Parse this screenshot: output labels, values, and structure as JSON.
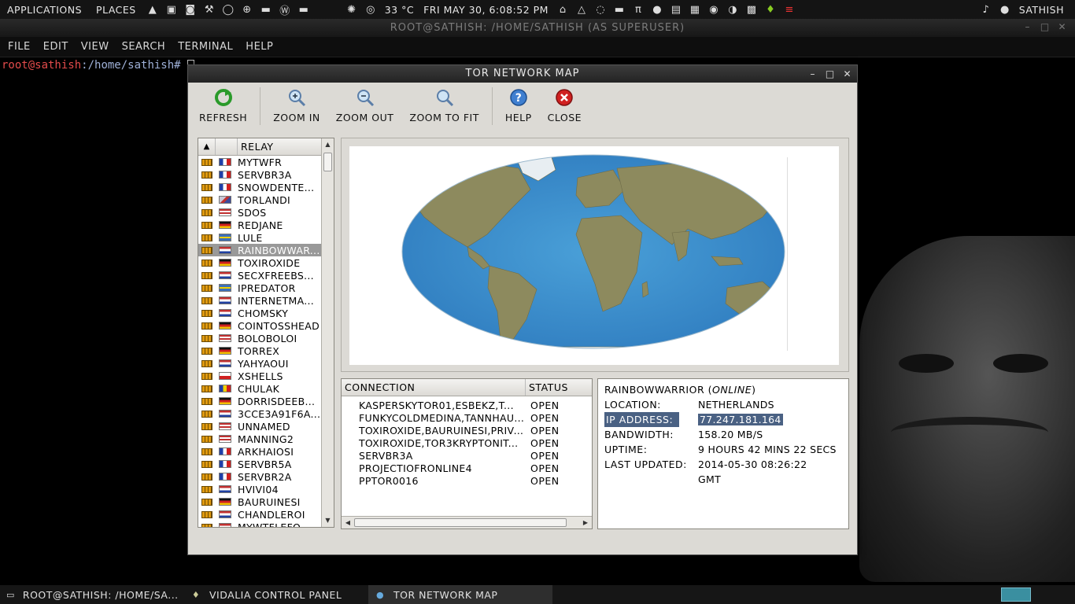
{
  "top_panel": {
    "applications": "APPLICATIONS",
    "places": "PLACES",
    "weather": "33 °C",
    "clock": "FRI MAY 30,  6:08:52 PM",
    "user": "SATHISH"
  },
  "terminal": {
    "title": "ROOT@SATHISH: /HOME/SATHISH (AS SUPERUSER)",
    "menu": [
      "FILE",
      "EDIT",
      "VIEW",
      "SEARCH",
      "TERMINAL",
      "HELP"
    ],
    "prompt_user": "root@sathish",
    "prompt_path": ":/home/sathish#"
  },
  "window": {
    "title": "TOR NETWORK MAP",
    "toolbar": {
      "refresh": "REFRESH",
      "zoom_in": "ZOOM IN",
      "zoom_out": "ZOOM OUT",
      "zoom_fit": "ZOOM TO FIT",
      "help": "HELP",
      "close": "CLOSE"
    }
  },
  "relay_list": {
    "header": "RELAY",
    "items": [
      {
        "name": "MYTWFR",
        "flag": "fr"
      },
      {
        "name": "SERVBR3A",
        "flag": "fr"
      },
      {
        "name": "SNOWDENTE...",
        "flag": "fr"
      },
      {
        "name": "TORLANDI",
        "flag": "gb"
      },
      {
        "name": "SDOS",
        "flag": "us"
      },
      {
        "name": "REDJANE",
        "flag": "de"
      },
      {
        "name": "LULE",
        "flag": "se"
      },
      {
        "name": "RAINBOWWAR...",
        "flag": "nl",
        "selected": true
      },
      {
        "name": "TOXIROXIDE",
        "flag": "de"
      },
      {
        "name": "SECXFREEBS...",
        "flag": "nl"
      },
      {
        "name": "IPREDATOR",
        "flag": "se"
      },
      {
        "name": "INTERNETMA...",
        "flag": "nl"
      },
      {
        "name": "CHOMSKY",
        "flag": "nl"
      },
      {
        "name": "COINTOSSHEAD",
        "flag": "de"
      },
      {
        "name": "BOLOBOLOI",
        "flag": "us"
      },
      {
        "name": "TORREX",
        "flag": "de"
      },
      {
        "name": "YAHYAOUI",
        "flag": "nl"
      },
      {
        "name": "XSHELLS",
        "flag": "pl"
      },
      {
        "name": "CHULAK",
        "flag": "ro"
      },
      {
        "name": "DORRISDEEB...",
        "flag": "de"
      },
      {
        "name": "3CCE3A91F6A...",
        "flag": "nl"
      },
      {
        "name": "UNNAMED",
        "flag": "us"
      },
      {
        "name": "MANNING2",
        "flag": "us"
      },
      {
        "name": "ARKHAIOSI",
        "flag": "fr"
      },
      {
        "name": "SERVBR5A",
        "flag": "fr"
      },
      {
        "name": "SERVBR2A",
        "flag": "fr"
      },
      {
        "name": "HVIVI04",
        "flag": "nl"
      },
      {
        "name": "BAURUINESI",
        "flag": "de"
      },
      {
        "name": "CHANDLEROI",
        "flag": "nl"
      },
      {
        "name": "MYWTFLEFO",
        "flag": "nl"
      }
    ]
  },
  "connections": {
    "header_connection": "CONNECTION",
    "header_status": "STATUS",
    "rows": [
      {
        "name": "KASPERSKYTOR01,ESBEKZ,T...",
        "status": "OPEN"
      },
      {
        "name": "FUNKYCOLDMEDINA,TANNHAU...",
        "status": "OPEN"
      },
      {
        "name": "TOXIROXIDE,BAURUINESI,PRIVA...",
        "status": "OPEN"
      },
      {
        "name": "TOXIROXIDE,TOR3KRYPTONIT...",
        "status": "OPEN"
      },
      {
        "name": "SERVBR3A",
        "status": "OPEN"
      },
      {
        "name": "PROJECTIOFRONLINE4",
        "status": "OPEN"
      },
      {
        "name": "PPTOR0016",
        "status": "OPEN"
      }
    ]
  },
  "info": {
    "relay": "RAINBOWWARRIOR",
    "state": "ONLINE",
    "location_label": "LOCATION:",
    "location": "NETHERLANDS",
    "ip_label": "IP ADDRESS:",
    "ip": "77.247.181.164",
    "bandwidth_label": "BANDWIDTH:",
    "bandwidth": "158.20 MB/S",
    "uptime_label": "UPTIME:",
    "uptime": "9 HOURS 42 MINS 22 SECS",
    "updated_label": "LAST UPDATED:",
    "updated": "2014-05-30 08:26:22",
    "updated_tz": "GMT"
  },
  "taskbar": {
    "tasks": [
      "ROOT@SATHISH: /HOME/SA...",
      "VIDALIA CONTROL PANEL",
      "TOR NETWORK MAP"
    ]
  },
  "colors": {
    "selected_row": "#999999",
    "highlight": "#4a6183",
    "ocean": "#3d8fcc",
    "land": "#8a8a5a"
  }
}
